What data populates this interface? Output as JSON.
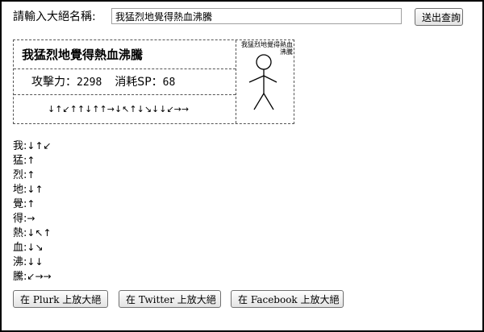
{
  "form": {
    "label": "請輸入大絕名稱:",
    "input_value": "我猛烈地覺得熱血沸騰",
    "submit_label": "送出查詢"
  },
  "card": {
    "title": "我猛烈地覺得熱血沸騰",
    "attack_label": "攻擊力：",
    "attack_value": "2298",
    "cost_label": "消耗SP：",
    "cost_value": "68",
    "combo": "↓↑↙↑↑↓↑↑→↓↖↑↓↘↓↓↙→→",
    "art_caption": "我猛烈地覺得熱血沸騰"
  },
  "breakdown": [
    {
      "char": "我",
      "arrows": "↓↑↙"
    },
    {
      "char": "猛",
      "arrows": "↑"
    },
    {
      "char": "烈",
      "arrows": "↑"
    },
    {
      "char": "地",
      "arrows": "↓↑"
    },
    {
      "char": "覺",
      "arrows": "↑"
    },
    {
      "char": "得",
      "arrows": "→"
    },
    {
      "char": "熱",
      "arrows": "↓↖↑"
    },
    {
      "char": "血",
      "arrows": "↓↘"
    },
    {
      "char": "沸",
      "arrows": "↓↓"
    },
    {
      "char": "騰",
      "arrows": "↙→→"
    }
  ],
  "share": {
    "plurk_label": "在 Plurk 上放大絕",
    "twitter_label": "在 Twitter 上放大絕",
    "facebook_label": "在 Facebook 上放大絕"
  },
  "colors": {
    "border": "#000000",
    "dashed": "#555555",
    "arrow_color": "#000000"
  },
  "icons": {
    "stick_figure": "stick-figure-icon"
  }
}
